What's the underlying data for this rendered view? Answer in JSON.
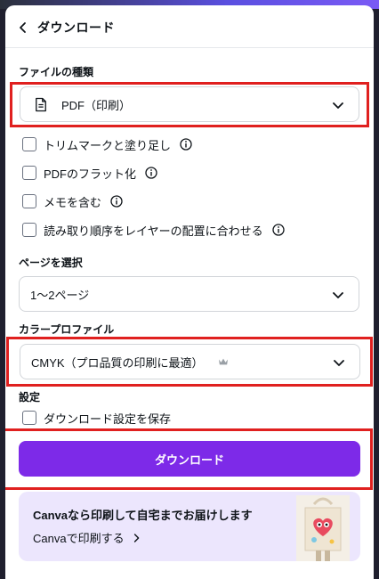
{
  "header": {
    "title": "ダウンロード"
  },
  "file_type": {
    "label": "ファイルの種類",
    "selected": "PDF（印刷）"
  },
  "options": [
    {
      "label": "トリムマークと塗り足し",
      "checked": false,
      "has_info": true
    },
    {
      "label": "PDFのフラット化",
      "checked": false,
      "has_info": true
    },
    {
      "label": "メモを含む",
      "checked": false,
      "has_info": true
    },
    {
      "label": "読み取り順序をレイヤーの配置に合わせる",
      "checked": false,
      "has_info": true
    }
  ],
  "page_select": {
    "label": "ページを選択",
    "selected": "1〜2ページ"
  },
  "color_profile": {
    "label": "カラープロファイル",
    "selected": "CMYK（プロ品質の印刷に最適）",
    "premium_icon": "crown-icon"
  },
  "settings": {
    "label": "設定",
    "save_label": "ダウンロード設定を保存"
  },
  "download_button": {
    "label": "ダウンロード"
  },
  "promo": {
    "title": "Canvaなら印刷して自宅までお届けします",
    "link": "Canvaで印刷する"
  },
  "colors": {
    "accent": "#7d2ae8",
    "highlight": "#e0201f",
    "promo_bg": "#ece6fd"
  }
}
